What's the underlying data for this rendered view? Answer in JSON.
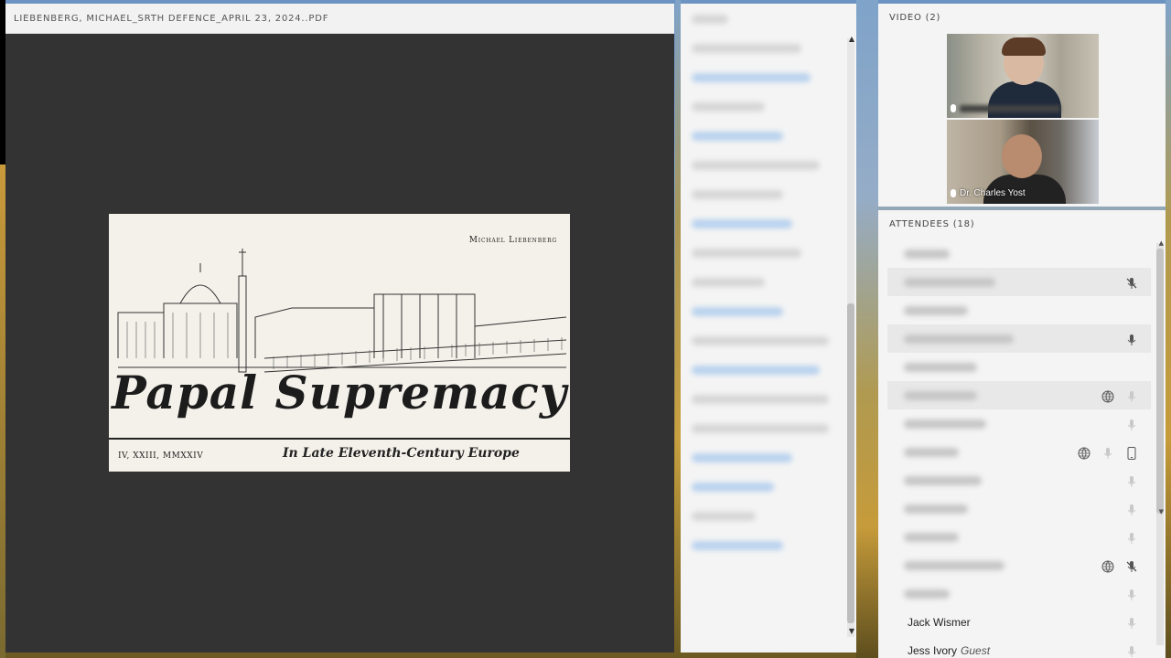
{
  "share": {
    "title": "LIEBENBERG, MICHAEL_SRTH DEFENCE_APRIL 23, 2024..PDF",
    "slide": {
      "author": "Michael Liebenberg",
      "title": "Papal Supremacy",
      "subtitle": "In Late Eleventh-Century Europe",
      "date": "IV, XXIII, MMXXIV"
    }
  },
  "video": {
    "label": "VIDEO (2)",
    "feeds": [
      {
        "name": ""
      },
      {
        "name": "Dr. Charles Yost"
      }
    ]
  },
  "attendees": {
    "label": "ATTENDEES  (18)",
    "rows": [
      {
        "name": "",
        "icons": []
      },
      {
        "name": "",
        "icons": [
          "mic-muted-icon"
        ]
      },
      {
        "name": "",
        "icons": []
      },
      {
        "name": "",
        "icons": [
          "mic-icon"
        ]
      },
      {
        "name": "",
        "icons": []
      },
      {
        "name": "",
        "icons": [
          "globe-icon",
          "mic-icon"
        ]
      },
      {
        "name": "",
        "icons": [
          "mic-icon"
        ]
      },
      {
        "name": "",
        "icons": [
          "globe-icon",
          "mic-icon",
          "phone-icon"
        ]
      },
      {
        "name": "",
        "icons": [
          "mic-icon"
        ]
      },
      {
        "name": "",
        "icons": [
          "mic-icon"
        ]
      },
      {
        "name": "",
        "icons": [
          "mic-icon"
        ]
      },
      {
        "name": "",
        "icons": [
          "globe-icon",
          "mic-muted-icon"
        ]
      },
      {
        "name": "",
        "icons": [
          "mic-icon"
        ]
      },
      {
        "name": "Jack Wismer",
        "icons": [
          "mic-icon"
        ]
      },
      {
        "name": "Jess Ivory",
        "guest": "Guest",
        "icons": [
          "mic-icon"
        ]
      }
    ]
  }
}
